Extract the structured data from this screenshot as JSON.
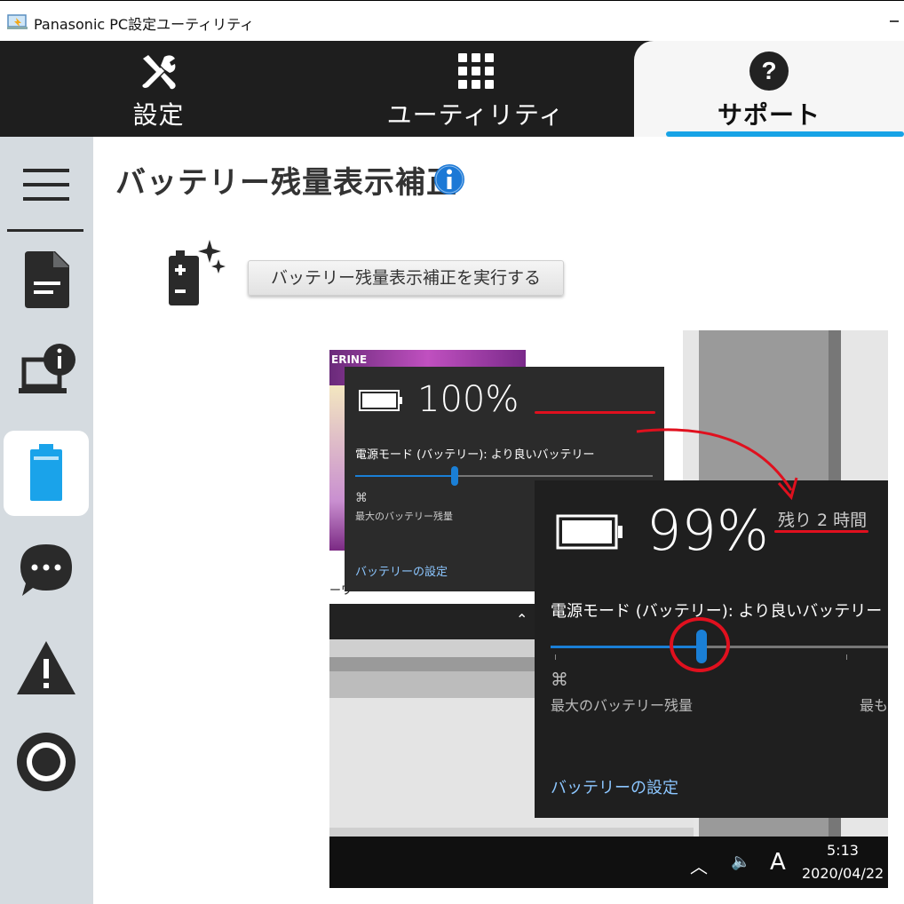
{
  "window": {
    "title": "Panasonic PC設定ユーティリティ"
  },
  "tabs": [
    {
      "label": "設定",
      "icon": "tools-icon"
    },
    {
      "label": "ユーティリティ",
      "icon": "grid-icon"
    },
    {
      "label": "サポート",
      "icon": "help-icon",
      "selected": true
    }
  ],
  "sidebar": {
    "items": [
      {
        "icon": "menu-icon"
      },
      {
        "icon": "document-icon"
      },
      {
        "icon": "pc-info-icon"
      },
      {
        "icon": "battery-icon",
        "active": true
      },
      {
        "icon": "chat-icon"
      },
      {
        "icon": "warning-icon"
      },
      {
        "icon": "target-icon"
      }
    ]
  },
  "main": {
    "title": "バッテリー残量表示補正",
    "run_button": "バッテリー残量表示補正を実行する"
  },
  "screenshot": {
    "ad_text": "ERINE",
    "lower_text": "ーワ",
    "flyout1": {
      "percent": "100%",
      "mode": "電源モード (バッテリー): より良いバッテリー",
      "max_label": "最大のバッテリー残量",
      "settings_link": "バッテリーの設定"
    },
    "flyout2": {
      "percent": "99%",
      "remaining": "残り 2 時間",
      "mode": "電源モード (バッテリー): より良いバッテリー",
      "max_label": "最大のバッテリー残量",
      "best_label": "最も",
      "settings_link": "バッテリーの設定"
    },
    "taskbar": {
      "ime": "A",
      "time": "5:13",
      "date": "2020/04/22"
    }
  },
  "colors": {
    "nav_bg": "#1e1e1e",
    "accent": "#17a3e6",
    "sidebar_bg": "#d5dbe0",
    "battery_active": "#1aa3ea",
    "annotation_red": "#e0101e"
  }
}
